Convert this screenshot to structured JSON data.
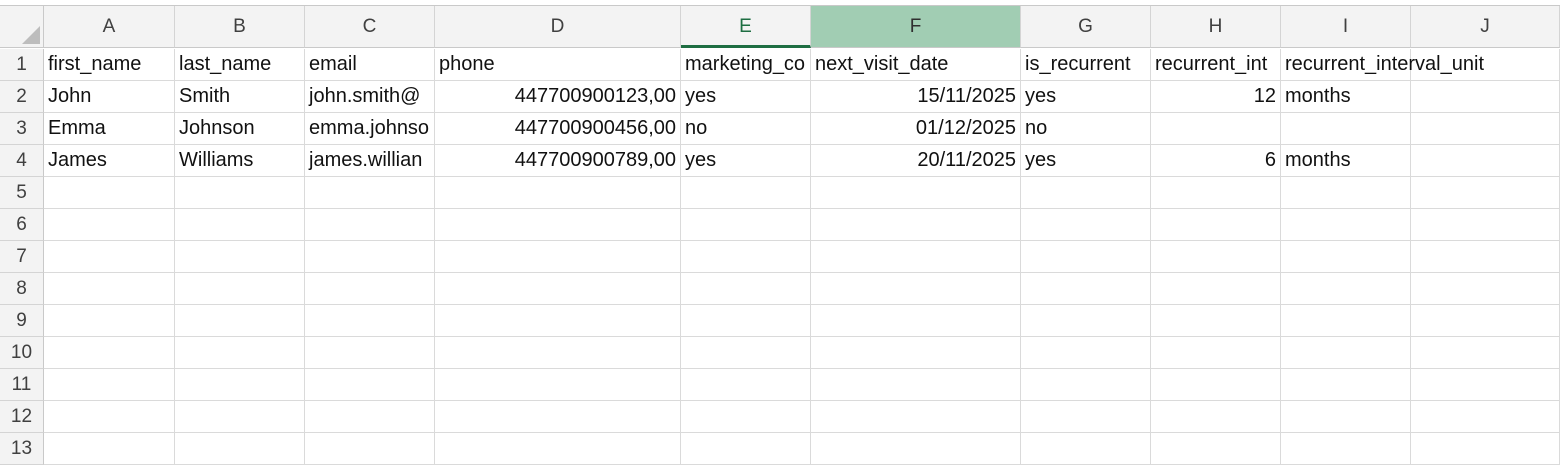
{
  "columns": [
    "A",
    "B",
    "C",
    "D",
    "E",
    "F",
    "G",
    "H",
    "I",
    "J"
  ],
  "row_numbers": [
    "1",
    "2",
    "3",
    "4",
    "5",
    "6",
    "7",
    "8",
    "9",
    "10",
    "11",
    "12",
    "13"
  ],
  "active_column": "E",
  "selected_column": "F",
  "rows": [
    [
      "first_name",
      "last_name",
      "email",
      "phone",
      "marketing_co",
      "next_visit_date",
      "is_recurrent",
      "recurrent_int",
      "recurrent_interval_unit",
      ""
    ],
    [
      "John",
      "Smith",
      "john.smith@",
      "447700900123,00",
      "yes",
      "15/11/2025",
      "yes",
      "12",
      "months",
      ""
    ],
    [
      "Emma",
      "Johnson",
      "emma.johnso",
      "447700900456,00",
      "no",
      "01/12/2025",
      "no",
      "",
      "",
      ""
    ],
    [
      "James",
      "Williams",
      "james.willian",
      "447700900789,00",
      "yes",
      "20/11/2025",
      "yes",
      "6",
      "months",
      ""
    ],
    [
      "",
      "",
      "",
      "",
      "",
      "",
      "",
      "",
      "",
      ""
    ],
    [
      "",
      "",
      "",
      "",
      "",
      "",
      "",
      "",
      "",
      ""
    ],
    [
      "",
      "",
      "",
      "",
      "",
      "",
      "",
      "",
      "",
      ""
    ],
    [
      "",
      "",
      "",
      "",
      "",
      "",
      "",
      "",
      "",
      ""
    ],
    [
      "",
      "",
      "",
      "",
      "",
      "",
      "",
      "",
      "",
      ""
    ],
    [
      "",
      "",
      "",
      "",
      "",
      "",
      "",
      "",
      "",
      ""
    ],
    [
      "",
      "",
      "",
      "",
      "",
      "",
      "",
      "",
      "",
      ""
    ],
    [
      "",
      "",
      "",
      "",
      "",
      "",
      "",
      "",
      "",
      ""
    ],
    [
      "",
      "",
      "",
      "",
      "",
      "",
      "",
      "",
      "",
      ""
    ]
  ],
  "numeric_cells": [
    "1.3",
    "2.3",
    "3.3",
    "1.5",
    "2.5",
    "3.5",
    "1.7",
    "3.7"
  ],
  "colors": {
    "active_header": "#1e6e42",
    "selected_header": "#a1cdb3",
    "header_bg": "#f3f3f3",
    "grid": "#dadada"
  }
}
